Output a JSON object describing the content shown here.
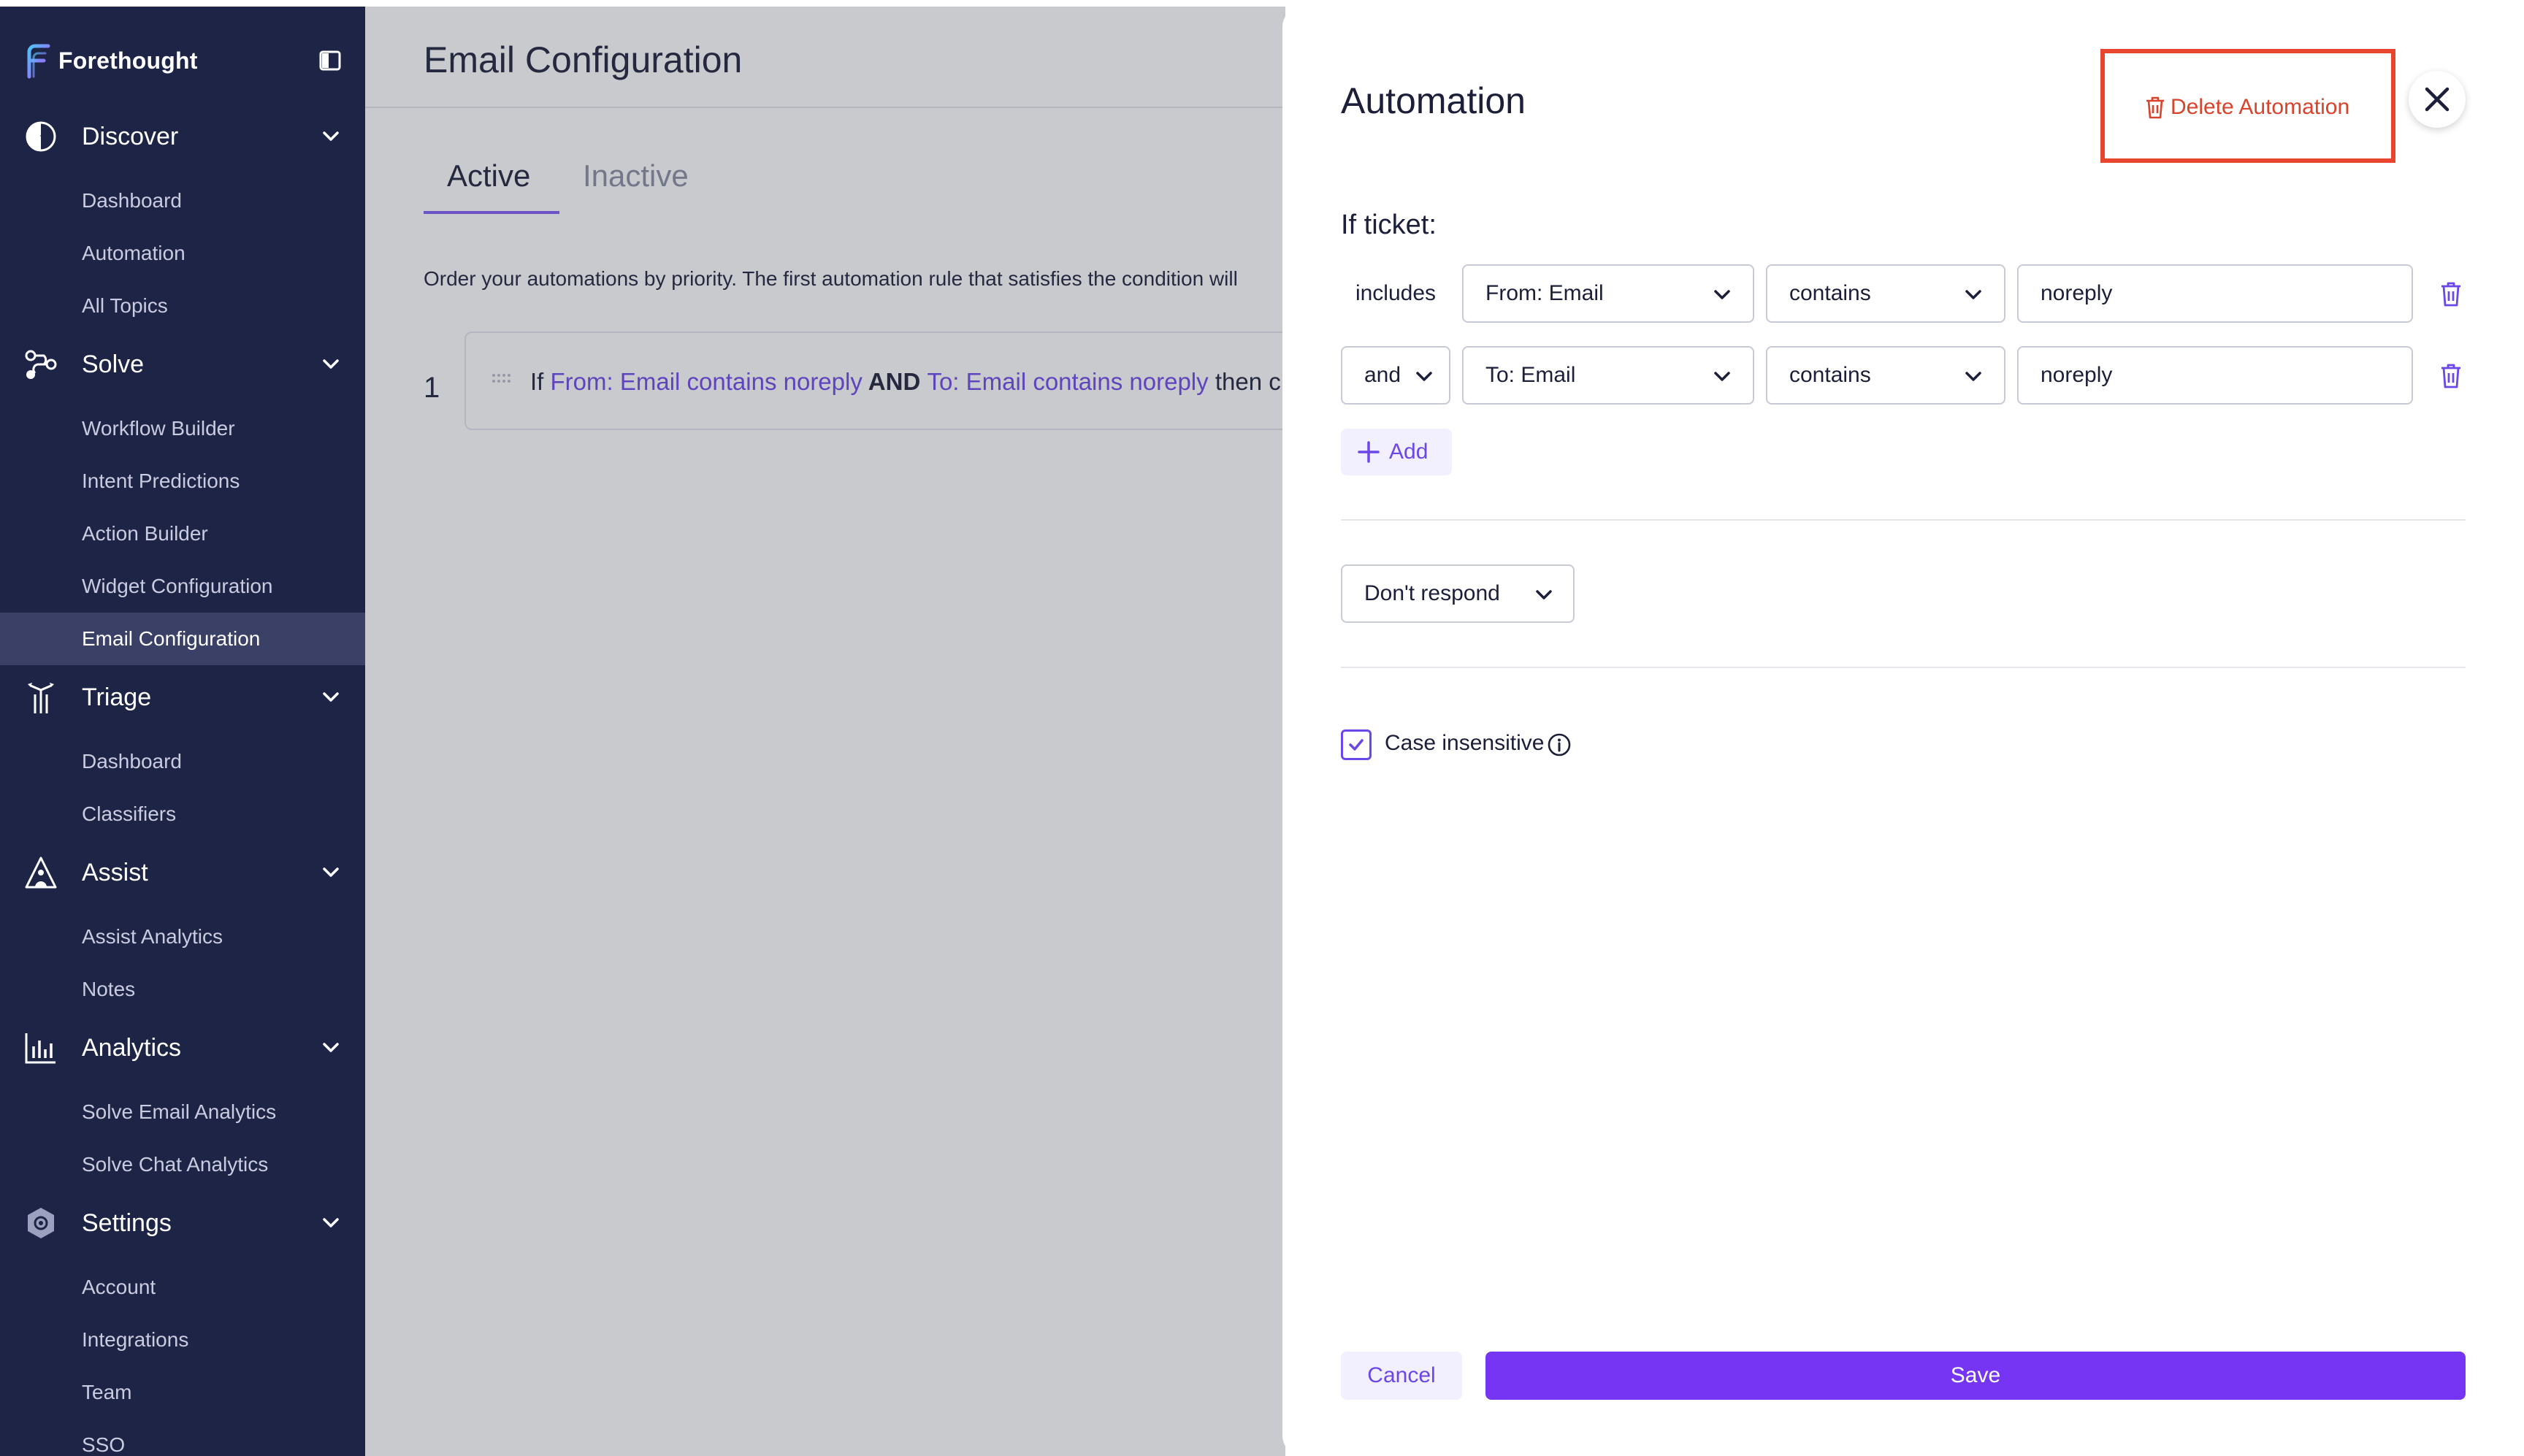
{
  "brand": {
    "name": "Forethought"
  },
  "sidebar": {
    "sections": [
      {
        "label": "Discover",
        "icon": "discover-icon",
        "items": [
          "Dashboard",
          "Automation",
          "All Topics"
        ]
      },
      {
        "label": "Solve",
        "icon": "solve-icon",
        "items": [
          "Workflow Builder",
          "Intent Predictions",
          "Action Builder",
          "Widget Configuration",
          "Email Configuration"
        ]
      },
      {
        "label": "Triage",
        "icon": "triage-icon",
        "items": [
          "Dashboard",
          "Classifiers"
        ]
      },
      {
        "label": "Assist",
        "icon": "assist-icon",
        "items": [
          "Assist Analytics",
          "Notes"
        ]
      },
      {
        "label": "Analytics",
        "icon": "analytics-icon",
        "items": [
          "Solve Email Analytics",
          "Solve Chat Analytics"
        ]
      },
      {
        "label": "Settings",
        "icon": "settings-icon",
        "items": [
          "Account",
          "Integrations",
          "Team",
          "SSO"
        ]
      }
    ],
    "active_item": "Email Configuration"
  },
  "main": {
    "title": "Email Configuration",
    "tabs": [
      {
        "label": "Active"
      },
      {
        "label": "Inactive"
      }
    ],
    "description": "Order your automations by priority. The first automation rule that satisfies the condition will",
    "rule": {
      "number": "1",
      "prefix": "If ",
      "cond1": "From: Email contains noreply",
      "joiner": " AND ",
      "cond2": "To: Email contains noreply",
      "suffix": " then c"
    }
  },
  "drawer": {
    "title": "Automation",
    "delete_label": "Delete Automation",
    "if_ticket_label": "If ticket:",
    "conditions": [
      {
        "logic": "includes",
        "field": "From: Email",
        "operator": "contains",
        "value": "noreply"
      },
      {
        "logic": "and",
        "field": "To: Email",
        "operator": "contains",
        "value": "noreply"
      }
    ],
    "add_label": "Add",
    "response": "Don't respond",
    "case_insensitive_label": "Case insensitive",
    "case_insensitive_checked": true,
    "cancel_label": "Cancel",
    "save_label": "Save"
  },
  "colors": {
    "sidebar_bg": "#1e2445",
    "accent": "#7535f2",
    "link": "#6b46e8",
    "danger": "#d9432b",
    "highlight_box": "#e8452f"
  }
}
